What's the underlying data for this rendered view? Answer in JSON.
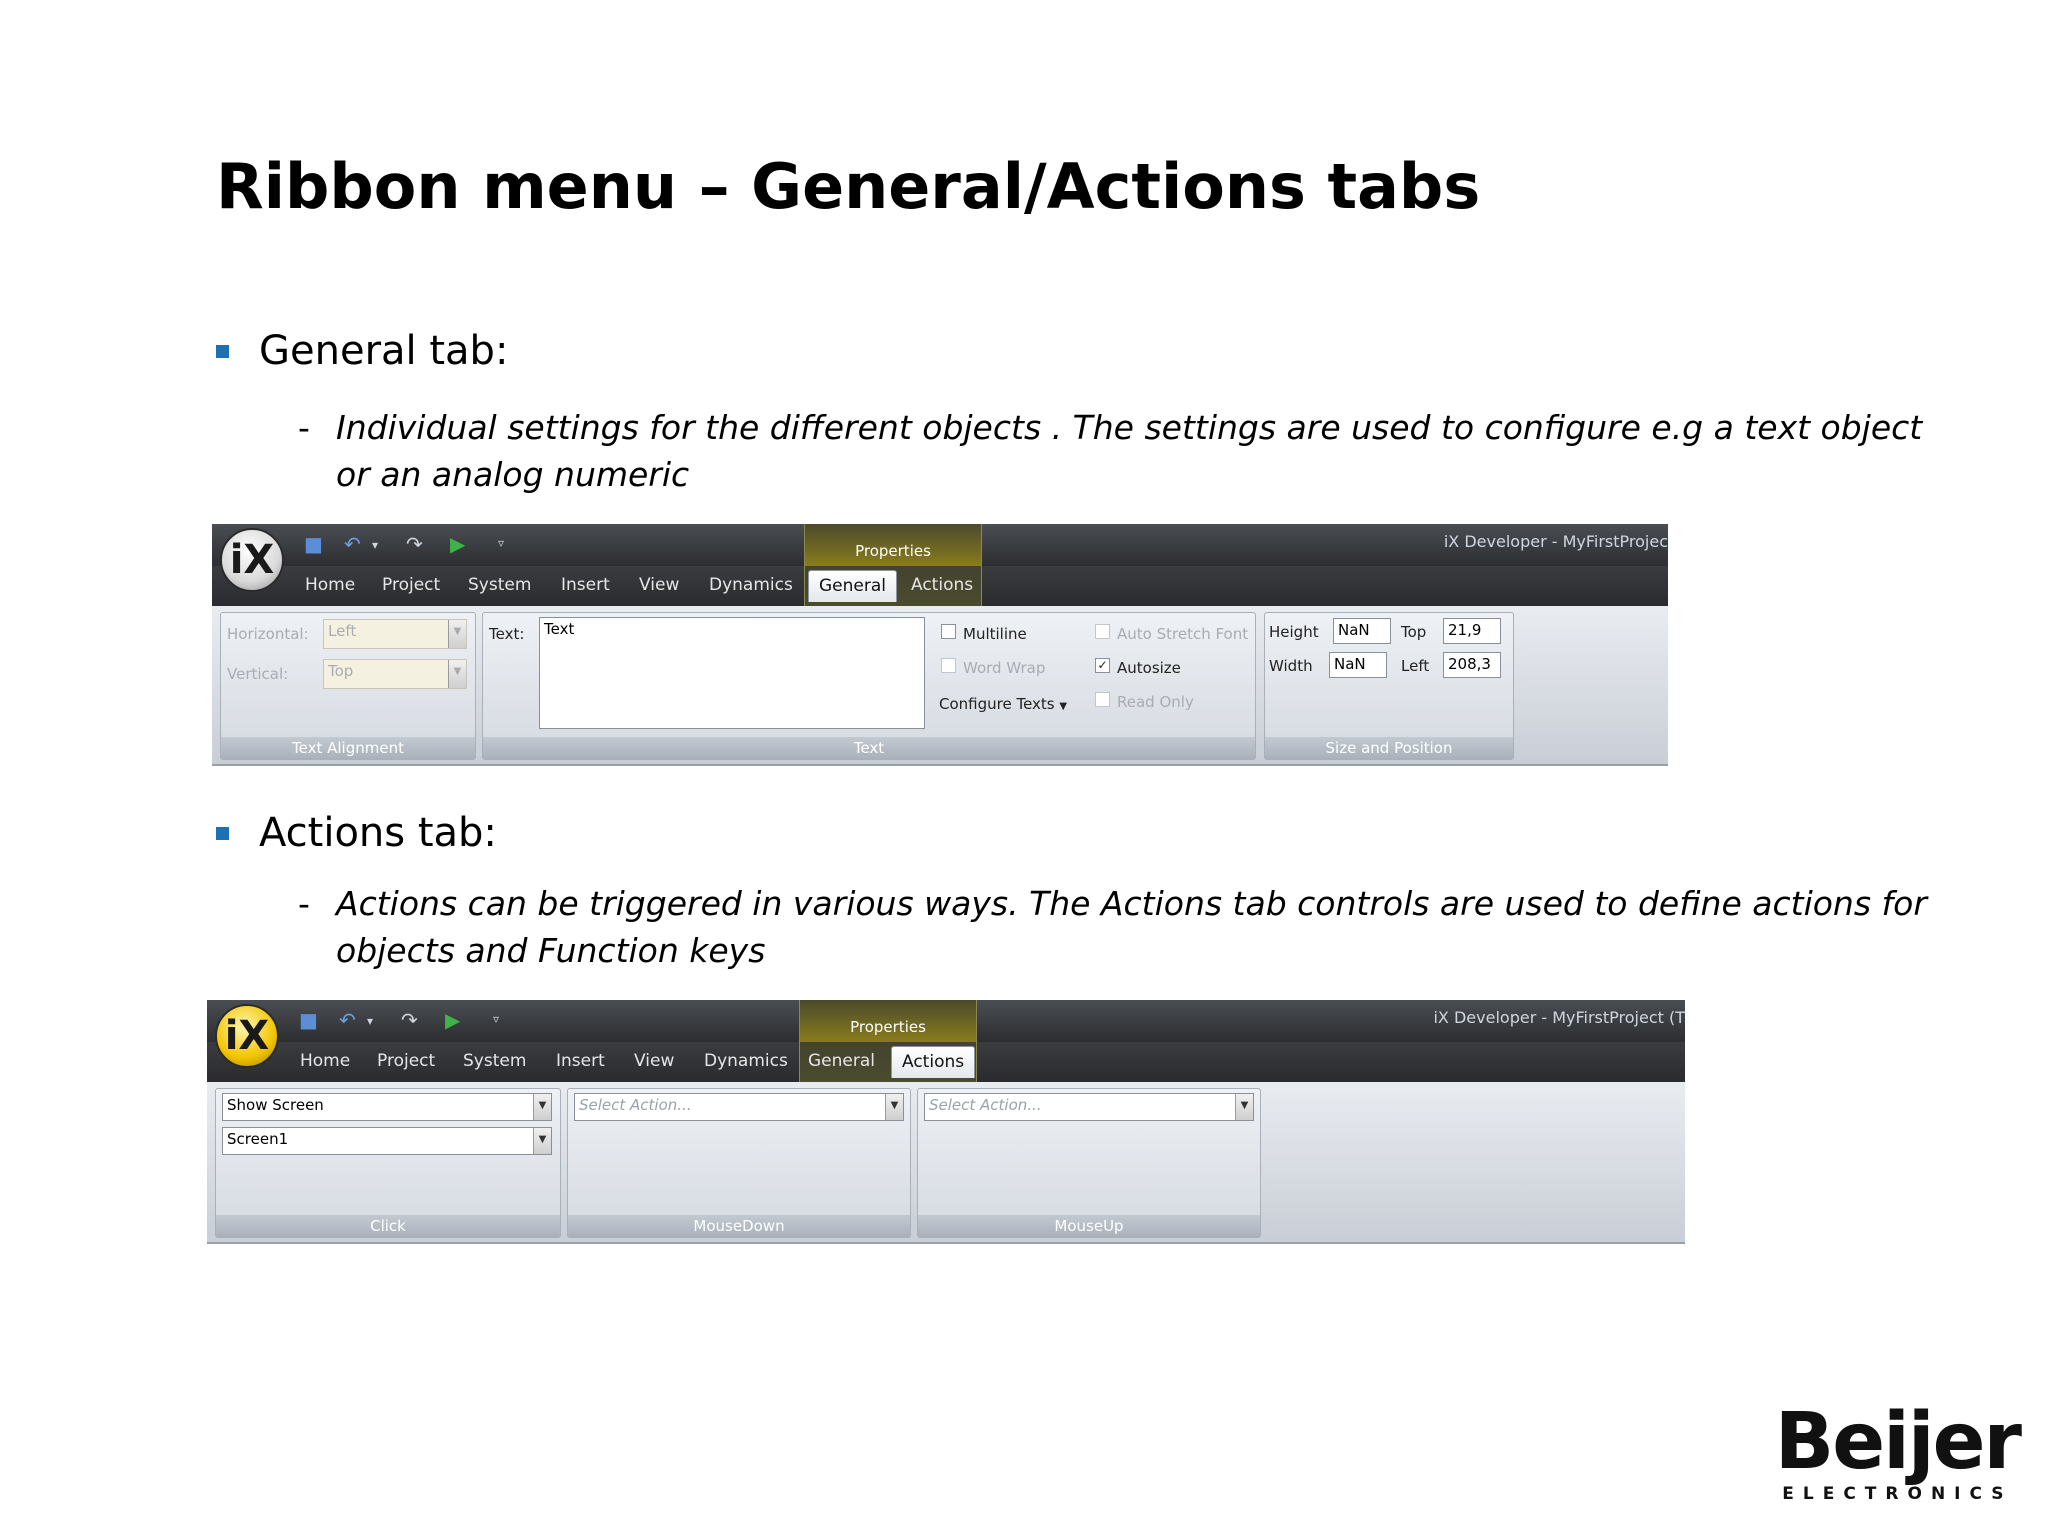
{
  "slide": {
    "title": "Ribbon menu – General/Actions tabs",
    "bullets": [
      {
        "heading": "General tab:",
        "dash": "-",
        "text": "Individual settings for the different objects . The settings are used to configure e.g a text object or an analog numeric"
      },
      {
        "heading": "Actions tab:",
        "dash": "-",
        "text": "Actions can be triggered in various ways. The Actions tab controls are used to define actions for objects and Function keys"
      }
    ]
  },
  "ribbon_general": {
    "logo": "iX",
    "contextual_group": "Properties",
    "app_title": "iX Developer - MyFirstProjec",
    "tabs": [
      "Home",
      "Project",
      "System",
      "Insert",
      "View",
      "Dynamics",
      "General",
      "Actions"
    ],
    "active_tab": "General",
    "groups": {
      "text_alignment": {
        "label": "Text Alignment",
        "horizontal_label": "Horizontal:",
        "horizontal_value": "Left",
        "vertical_label": "Vertical:",
        "vertical_value": "Top"
      },
      "text": {
        "label": "Text",
        "text_label": "Text:",
        "text_value": "Text",
        "multiline": "Multiline",
        "word_wrap": "Word Wrap",
        "configure_texts": "Configure Texts",
        "auto_stretch_font": "Auto Stretch Font",
        "autosize": "Autosize",
        "read_only": "Read Only"
      },
      "size_position": {
        "label": "Size and Position",
        "height_label": "Height",
        "height_value": "NaN",
        "width_label": "Width",
        "width_value": "NaN",
        "top_label": "Top",
        "top_value": "21,9",
        "left_label": "Left",
        "left_value": "208,3"
      }
    }
  },
  "ribbon_actions": {
    "logo": "iX",
    "contextual_group": "Properties",
    "app_title": "iX Developer - MyFirstProject (T",
    "tabs": [
      "Home",
      "Project",
      "System",
      "Insert",
      "View",
      "Dynamics",
      "General",
      "Actions"
    ],
    "active_tab": "Actions",
    "groups": {
      "click": {
        "label": "Click",
        "action": "Show Screen",
        "target": "Screen1"
      },
      "mousedown": {
        "label": "MouseDown",
        "placeholder": "Select Action..."
      },
      "mouseup": {
        "label": "MouseUp",
        "placeholder": "Select Action..."
      }
    }
  },
  "brand": {
    "name": "Beijer",
    "sub": "ELECTRONICS",
    "accent": "#e2001a"
  }
}
